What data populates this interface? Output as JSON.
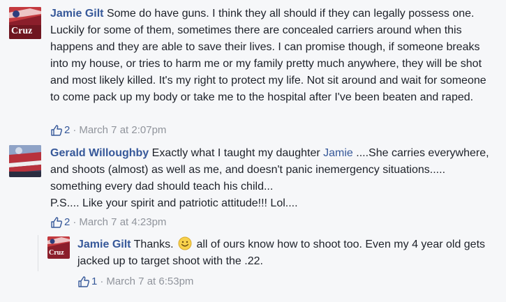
{
  "comments": [
    {
      "author": "Jamie Gilt",
      "avatar_text": "Cruz",
      "text": "Some do have guns. I think they all should if they can legally possess one. Luckily for some of them, sometimes there are concealed carriers around when this happens and they are able to save their lives. I can promise though, if someone breaks into my house, or tries to harm me or my family pretty much anywhere, they will be shot and most likely killed. It's my right to protect my life. Not sit around and wait for someone to come pack up my body or take me to the hospital after I've been beaten and raped.",
      "likes": "2",
      "time": "March 7 at 2:07pm"
    },
    {
      "author": "Gerald Willoughby",
      "text_before_mention": "Exactly what I taught my daughter",
      "mention": "Jamie",
      "text_after_mention": "....She carries everywhere, and shoots (almost) as well as me, and doesn't panic inemergency situations..... something every dad should teach his child...",
      "text_line2": "P.S.... Like your spirit and patriotic attitude!!! Lol....",
      "likes": "2",
      "time": "March 7 at 4:23pm"
    },
    {
      "author": "Jamie Gilt",
      "avatar_text": "Cruz",
      "text_before_emoji": "Thanks.",
      "text_after_emoji": "all of ours know how to shoot too. Even my 4 year old gets jacked up to target shoot with the .22.",
      "likes": "1",
      "time": "March 7 at 6:53pm"
    }
  ],
  "separator": "·",
  "colors": {
    "link": "#365899",
    "meta": "#90949c",
    "text": "#1d2129",
    "background": "#f6f7f9"
  },
  "icons": {
    "like": "thumbs-up-outline-icon",
    "emoji": "smiley-face-icon"
  }
}
